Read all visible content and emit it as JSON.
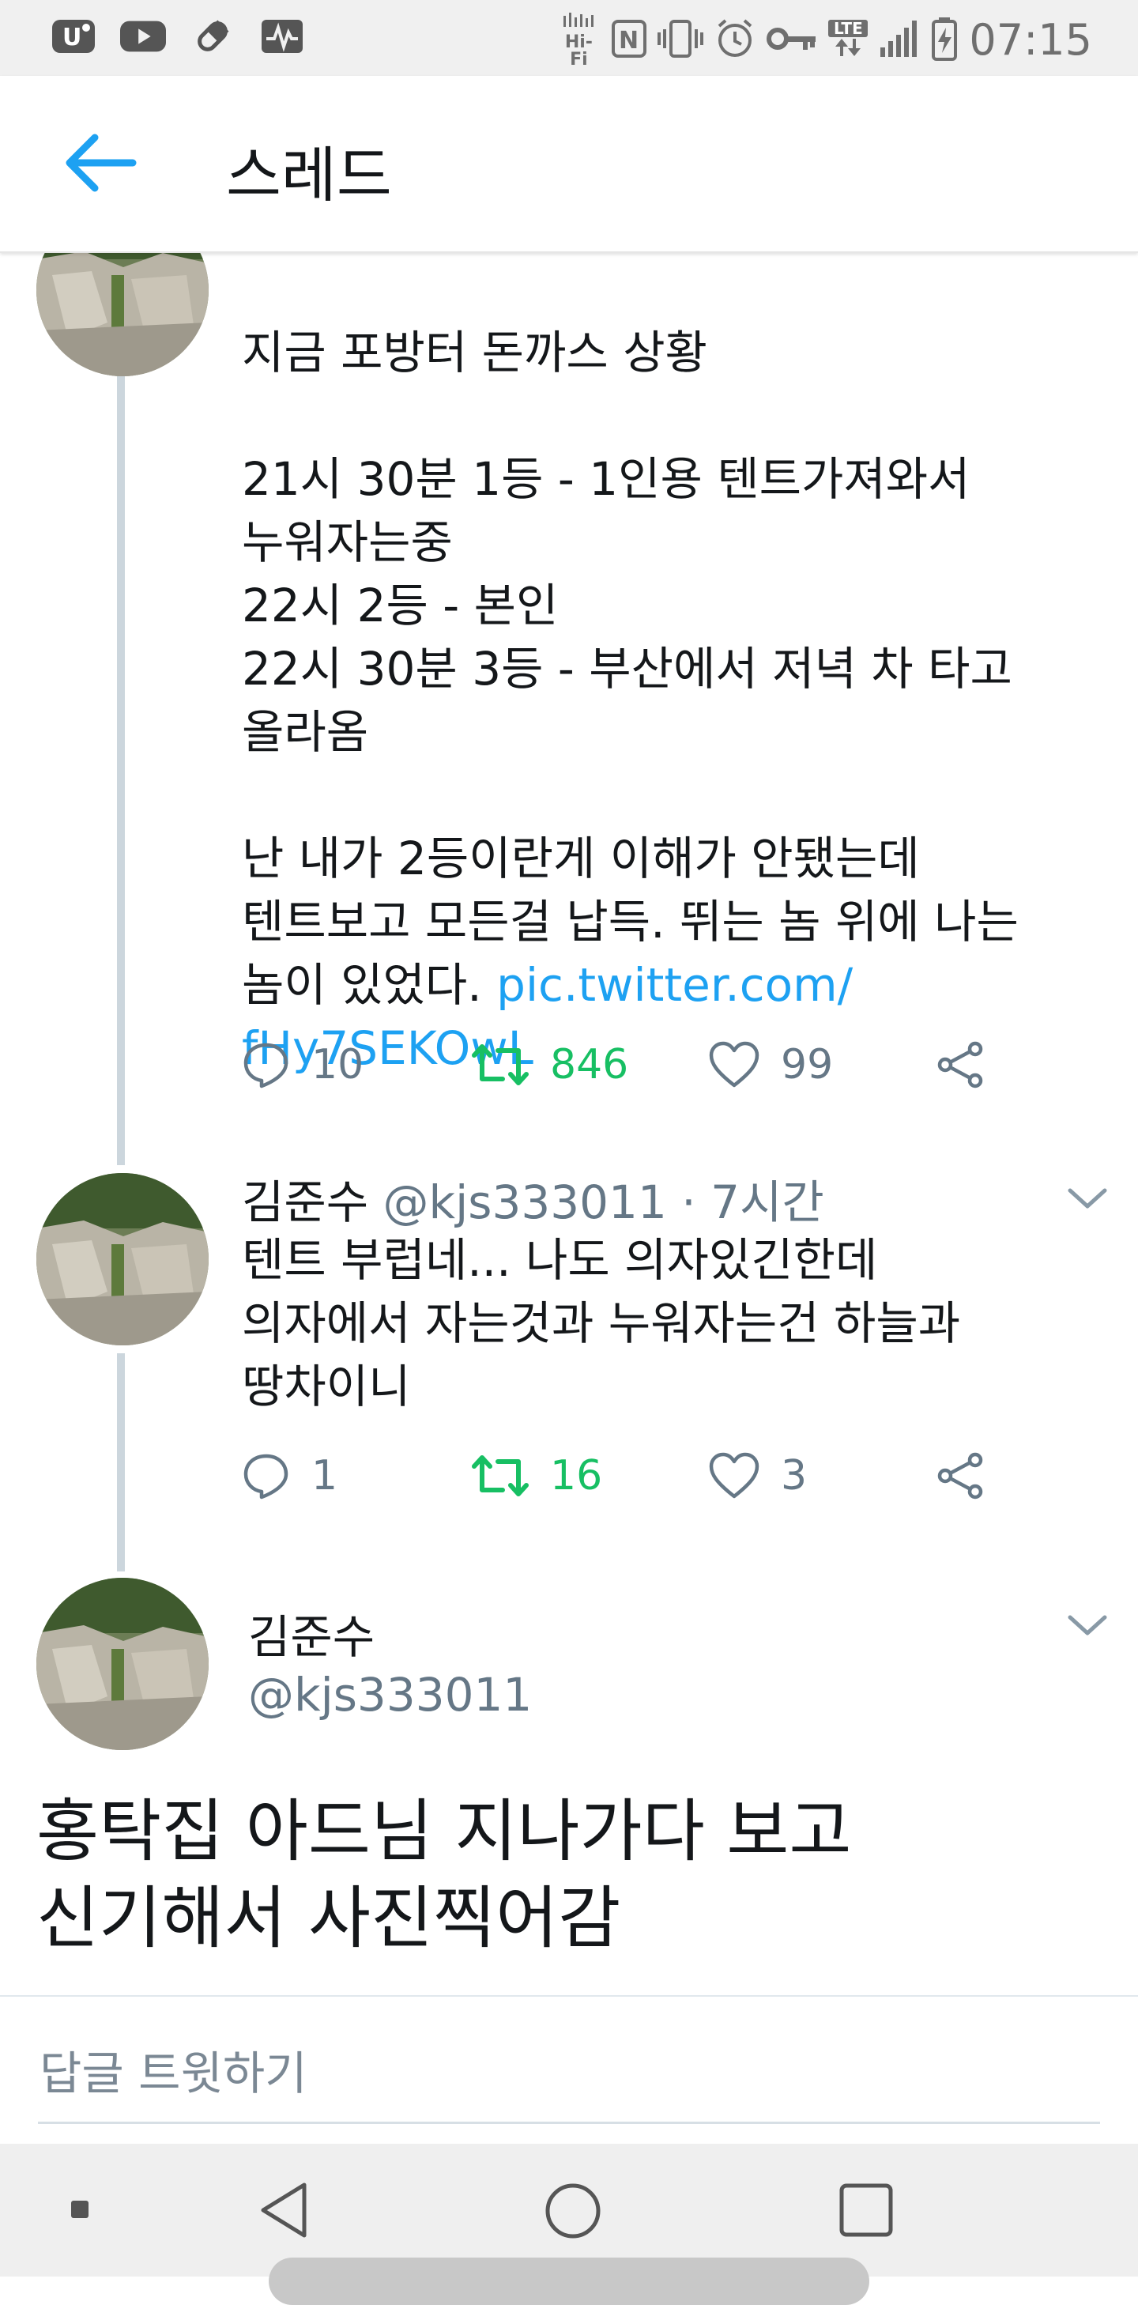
{
  "status_bar": {
    "time": "07:15",
    "left_icons": [
      "app-u-icon",
      "youtube-icon",
      "pill-icon",
      "activity-icon"
    ],
    "right_icons": [
      "hifi-icon",
      "nfc-icon",
      "vibrate-icon",
      "alarm-icon",
      "key-icon",
      "lte-icon",
      "signal-icon",
      "battery-charging-icon"
    ],
    "hifi_label": "Hi-Fi",
    "lte_label": "LTE"
  },
  "header": {
    "title": "스레드"
  },
  "tweet1": {
    "text": "지금 포방터 돈까스 상황\n\n21시 30분 1등 - 1인용 텐트가져와서\n누워자는중\n22시 2등 - 본인\n22시 30분 3등 - 부산에서 저녁 차 타고\n올라옴\n\n난 내가 2등이란게 이해가 안됐는데\n텐트보고 모든걸 납득. 뛰는 놈 위에 나는\n놈이 있었다. ",
    "link_line1": "pic.twitter.com/",
    "link_line2": "fHy7SEKOwL",
    "replies": "10",
    "retweets": "846",
    "likes": "99"
  },
  "tweet2": {
    "name": "김준수",
    "handle": "@kjs333011",
    "separator": "·",
    "time": "7시간",
    "text": "텐트     부럽네... 나도 의자있긴한데\n의자에서 자는것과 누워자는건 하늘과\n땅차이니",
    "replies": "1",
    "retweets": "16",
    "likes": "3"
  },
  "tweet3": {
    "name": "김준수",
    "handle": "@kjs333011",
    "text_line1": "홍탁집 아드님 지나가다 보고",
    "text_line2": "신기해서 사진찍어감"
  },
  "reply_box": {
    "placeholder": "답글 트윗하기"
  },
  "colors": {
    "accent": "#1da1f2",
    "retweet": "#17bf63",
    "muted": "#657786",
    "thread_line": "#ccd6dd"
  }
}
